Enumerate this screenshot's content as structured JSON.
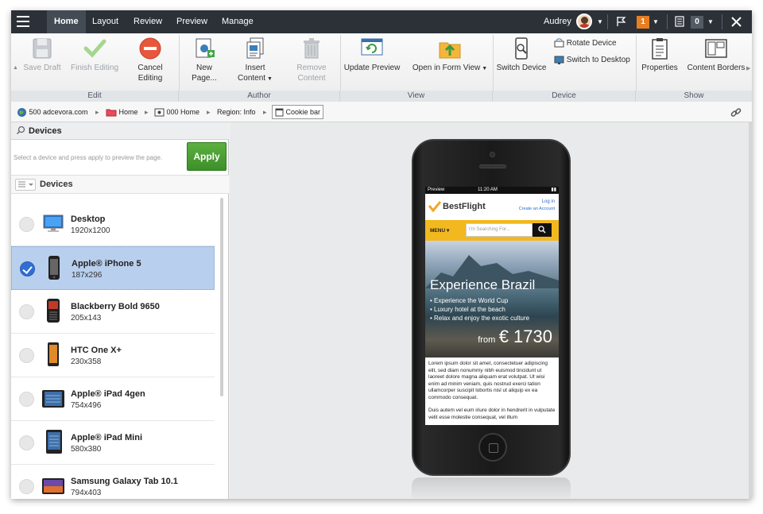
{
  "topbar": {
    "tabs": [
      "Home",
      "Layout",
      "Review",
      "Preview",
      "Manage"
    ],
    "user": "Audrey",
    "notifications_count": "1",
    "tasks_count": "0"
  },
  "ribbon": {
    "edit": {
      "label": "Edit",
      "save_draft": "Save Draft",
      "finish_editing": "Finish Editing",
      "cancel_editing_1": "Cancel",
      "cancel_editing_2": "Editing"
    },
    "author": {
      "label": "Author",
      "new_page_1": "New",
      "new_page_2": "Page...",
      "insert_content_1": "Insert",
      "insert_content_2": "Content",
      "remove_content_1": "Remove",
      "remove_content_2": "Content"
    },
    "view": {
      "label": "View",
      "update_preview": "Update Preview",
      "open_in_form_view": "Open in Form View"
    },
    "device": {
      "label": "Device",
      "switch_device": "Switch Device",
      "rotate_device": "Rotate Device",
      "switch_to_desktop": "Switch to Desktop"
    },
    "show": {
      "label": "Show",
      "properties": "Properties",
      "content_borders": "Content Borders"
    }
  },
  "breadcrumb": {
    "site": "500 adcevora.com",
    "home": "Home",
    "page": "000 Home",
    "region": "Region: Info",
    "component": "Cookie bar"
  },
  "devices_panel": {
    "title": "Devices",
    "hint": "Select a device and press apply to preview the page.",
    "apply": "Apply",
    "list_header": "Devices",
    "devices": [
      {
        "name": "Desktop",
        "size": "1920x1200",
        "selected": false
      },
      {
        "name": "Apple® iPhone 5",
        "size": "187x296",
        "selected": true
      },
      {
        "name": "Blackberry Bold 9650",
        "size": "205x143",
        "selected": false
      },
      {
        "name": "HTC One X+",
        "size": "230x358",
        "selected": false
      },
      {
        "name": "Apple® iPad 4gen",
        "size": "754x496",
        "selected": false
      },
      {
        "name": "Apple® iPad Mini",
        "size": "580x380",
        "selected": false
      },
      {
        "name": "Samsung Galaxy Tab 10.1",
        "size": "794x403",
        "selected": false
      }
    ]
  },
  "preview_site": {
    "status_left": "Preview",
    "status_time": "11:20 AM",
    "brand": "BestFlight",
    "login": "Log in",
    "create_account": "Create an Account",
    "menu": "MENU",
    "search_placeholder": "I'm Searching For...",
    "hero_title": "Experience Brazil",
    "bullets": [
      "Experience the World Cup",
      "Luxury hotel at the beach",
      "Relax and enjoy the exotic culture"
    ],
    "price_from": "from",
    "price": "€ 1730",
    "para1": "Lorem ipsum dolor sit amet, consectetuer adipiscing elit, sed diam nonummy nibh euismod tincidunt ut laoreet dolore magna aliquam erat volutpat. Ut wisi enim ad minim veniam, quis nostrud exerci tation ullamcorper suscipit lobortis nisl ut aliquip ex ea commodo consequat.",
    "para2": "Duis autem vel eum iriure dolor in hendrerit in vulputate velit esse molestie consequat, vel illum"
  }
}
